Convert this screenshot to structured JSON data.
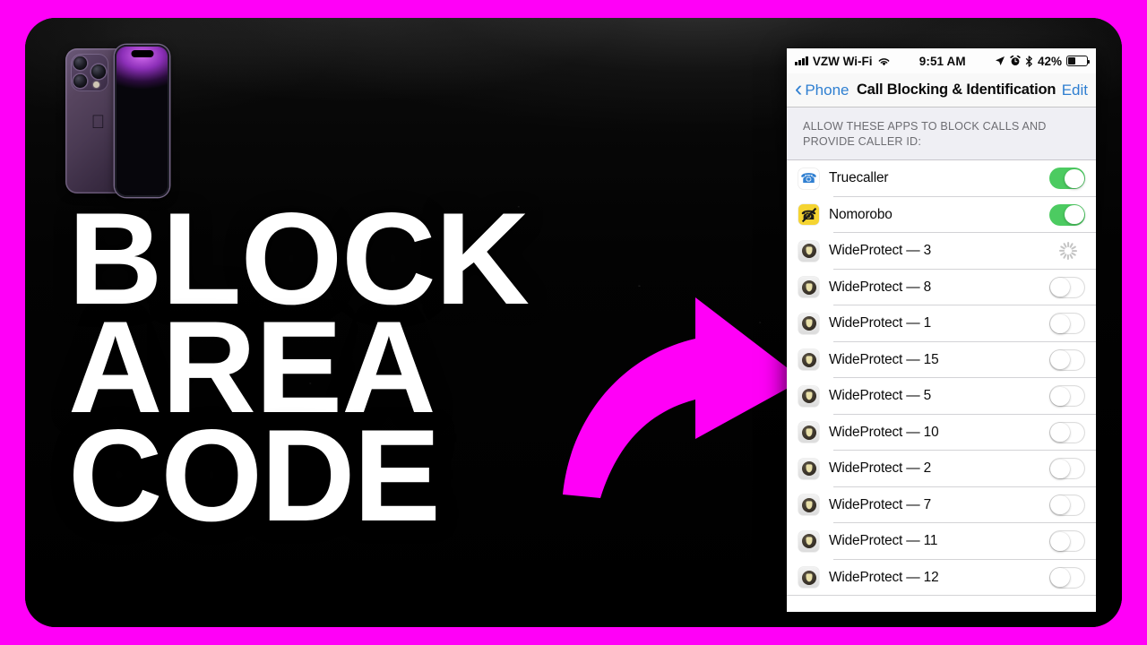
{
  "thumbnail": {
    "border_color": "#FF00F7",
    "headline_lines": [
      "BLOCK",
      "AREA",
      "CODE"
    ],
    "headline_color": "#FFFFFF",
    "arrow_color": "#FF00F7",
    "arrow_name": "curved-arrow-pointing-right"
  },
  "product_render": {
    "device_back_label": "iPhone 14 Pro back, deep purple",
    "device_front_label": "iPhone 14 Pro front, purple gradient wallpaper",
    "apple_logo": ""
  },
  "ios": {
    "status_bar": {
      "carrier": "VZW Wi-Fi",
      "time": "9:51 AM",
      "battery_percent": "42%",
      "battery_level": 42,
      "icons": [
        "signal-bars-icon",
        "wifi-icon",
        "location-arrow-icon",
        "alarm-clock-icon",
        "bluetooth-icon",
        "battery-icon"
      ]
    },
    "nav_bar": {
      "back_label": "Phone",
      "title": "Call Blocking & Identification",
      "edit_label": "Edit",
      "tint_color": "#2F7FD1"
    },
    "section_header": "ALLOW THESE APPS TO BLOCK CALLS AND PROVIDE CALLER ID:",
    "toggle_on_color": "#4CCB61",
    "rows": [
      {
        "label": "Truecaller",
        "icon": "truecaller-icon",
        "control": "toggle",
        "state": "on"
      },
      {
        "label": "Nomorobo",
        "icon": "nomorobo-icon",
        "control": "toggle",
        "state": "on"
      },
      {
        "label": "WideProtect — 3",
        "icon": "wideprotect-icon",
        "control": "spinner",
        "state": "loading"
      },
      {
        "label": "WideProtect — 8",
        "icon": "wideprotect-icon",
        "control": "toggle",
        "state": "off"
      },
      {
        "label": "WideProtect — 1",
        "icon": "wideprotect-icon",
        "control": "toggle",
        "state": "off"
      },
      {
        "label": "WideProtect — 15",
        "icon": "wideprotect-icon",
        "control": "toggle",
        "state": "off"
      },
      {
        "label": "WideProtect — 5",
        "icon": "wideprotect-icon",
        "control": "toggle",
        "state": "off"
      },
      {
        "label": "WideProtect — 10",
        "icon": "wideprotect-icon",
        "control": "toggle",
        "state": "off"
      },
      {
        "label": "WideProtect — 2",
        "icon": "wideprotect-icon",
        "control": "toggle",
        "state": "off"
      },
      {
        "label": "WideProtect — 7",
        "icon": "wideprotect-icon",
        "control": "toggle",
        "state": "off"
      },
      {
        "label": "WideProtect — 11",
        "icon": "wideprotect-icon",
        "control": "toggle",
        "state": "off"
      },
      {
        "label": "WideProtect — 12",
        "icon": "wideprotect-icon",
        "control": "toggle",
        "state": "off"
      }
    ]
  }
}
